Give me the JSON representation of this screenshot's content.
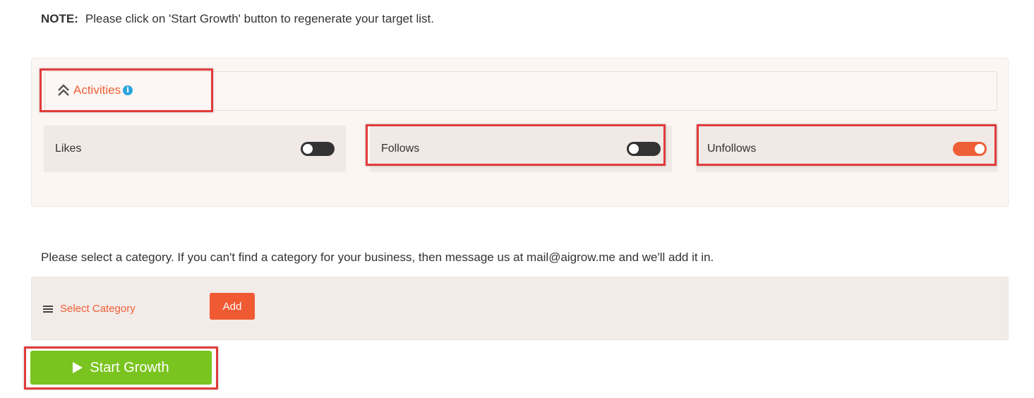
{
  "note": {
    "label": "NOTE:",
    "text": "Please click on 'Start Growth' button to regenerate your target list."
  },
  "activities": {
    "title": "Activities",
    "info_icon": "info-circle-icon",
    "toggles": [
      {
        "label": "Likes",
        "on": false
      },
      {
        "label": "Follows",
        "on": false
      },
      {
        "label": "Unfollows",
        "on": true
      }
    ]
  },
  "category": {
    "instruction": "Please select a category. If you can't find a category for your business, then message us at mail@aigrow.me and we'll add it in.",
    "select_label": "Select Category",
    "add_label": "Add"
  },
  "start_button": {
    "label": "Start Growth"
  },
  "colors": {
    "accent": "#ef5f37",
    "toggle_off": "#333333",
    "toggle_on": "#ef5f37",
    "start_green": "#7ac41f",
    "highlight": "#e03c3c",
    "info_blue": "#2aa4df"
  }
}
